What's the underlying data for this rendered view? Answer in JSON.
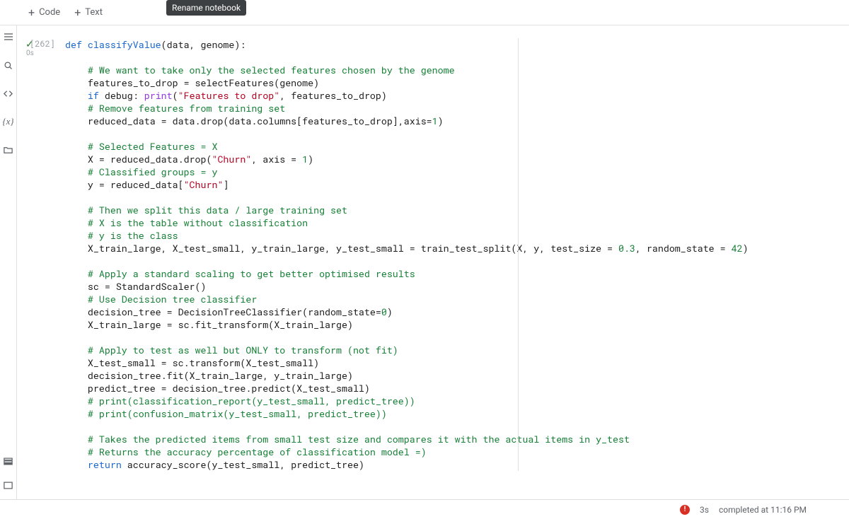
{
  "toolbar": {
    "code_label": "Code",
    "text_label": "Text"
  },
  "tooltip": "Rename notebook",
  "leftrail": {
    "icons": [
      "menu-icon",
      "toc-icon",
      "search-icon",
      "code-snippet-icon",
      "variables-icon",
      "folder-icon",
      "command-palette-icon",
      "terminal-icon"
    ]
  },
  "cell": {
    "exec_count": "[262]",
    "run_time_label": "0s",
    "code_lines": [
      {
        "t": "code",
        "seg": [
          [
            "kw",
            "def "
          ],
          [
            "fn",
            "classifyValue"
          ],
          [
            "id",
            "(data, genome):"
          ]
        ]
      },
      {
        "t": "blank"
      },
      {
        "t": "code",
        "seg": [
          [
            "id",
            "    "
          ],
          [
            "cm",
            "# We want to take only the selected features chosen by the genome"
          ]
        ]
      },
      {
        "t": "code",
        "seg": [
          [
            "id",
            "    features_to_drop = selectFeatures(genome)"
          ]
        ]
      },
      {
        "t": "code",
        "seg": [
          [
            "id",
            "    "
          ],
          [
            "kw",
            "if"
          ],
          [
            "id",
            " debug: "
          ],
          [
            "bn",
            "print"
          ],
          [
            "id",
            "("
          ],
          [
            "str",
            "\"Features to drop\""
          ],
          [
            "id",
            ", features_to_drop)"
          ]
        ]
      },
      {
        "t": "code",
        "seg": [
          [
            "id",
            "    "
          ],
          [
            "cm",
            "# Remove features from training set"
          ]
        ]
      },
      {
        "t": "code",
        "seg": [
          [
            "id",
            "    reduced_data = data.drop(data.columns[features_to_drop],axis="
          ],
          [
            "num",
            "1"
          ],
          [
            "id",
            ")"
          ]
        ]
      },
      {
        "t": "blank"
      },
      {
        "t": "code",
        "seg": [
          [
            "id",
            "    "
          ],
          [
            "cm",
            "# Selected Features = X"
          ]
        ]
      },
      {
        "t": "code",
        "seg": [
          [
            "id",
            "    X = reduced_data.drop("
          ],
          [
            "str",
            "\"Churn\""
          ],
          [
            "id",
            ", axis = "
          ],
          [
            "num",
            "1"
          ],
          [
            "id",
            ")"
          ]
        ]
      },
      {
        "t": "code",
        "seg": [
          [
            "id",
            "    "
          ],
          [
            "cm",
            "# Classified groups = y"
          ]
        ]
      },
      {
        "t": "code",
        "seg": [
          [
            "id",
            "    y = reduced_data["
          ],
          [
            "str",
            "\"Churn\""
          ],
          [
            "id",
            "]"
          ]
        ]
      },
      {
        "t": "blank"
      },
      {
        "t": "code",
        "seg": [
          [
            "id",
            "    "
          ],
          [
            "cm",
            "# Then we split this data / large training set"
          ]
        ]
      },
      {
        "t": "code",
        "seg": [
          [
            "id",
            "    "
          ],
          [
            "cm",
            "# X is the table without classification"
          ]
        ]
      },
      {
        "t": "code",
        "seg": [
          [
            "id",
            "    "
          ],
          [
            "cm",
            "# y is the class"
          ]
        ]
      },
      {
        "t": "code",
        "seg": [
          [
            "id",
            "    X_train_large, X_test_small, y_train_large, y_test_small = train_test_split(X, y, test_size = "
          ],
          [
            "num",
            "0.3"
          ],
          [
            "id",
            ", random_state = "
          ],
          [
            "num",
            "42"
          ],
          [
            "id",
            ")"
          ]
        ]
      },
      {
        "t": "blank"
      },
      {
        "t": "code",
        "seg": [
          [
            "id",
            "    "
          ],
          [
            "cm",
            "# Apply a standard scaling to get better optimised results"
          ]
        ]
      },
      {
        "t": "code",
        "seg": [
          [
            "id",
            "    sc = StandardScaler()"
          ]
        ]
      },
      {
        "t": "code",
        "seg": [
          [
            "id",
            "    "
          ],
          [
            "cm",
            "# Use Decision tree classifier"
          ]
        ]
      },
      {
        "t": "code",
        "seg": [
          [
            "id",
            "    decision_tree = DecisionTreeClassifier(random_state="
          ],
          [
            "num",
            "0"
          ],
          [
            "id",
            ")"
          ]
        ]
      },
      {
        "t": "code",
        "seg": [
          [
            "id",
            "    X_train_large = sc.fit_transform(X_train_large)"
          ]
        ]
      },
      {
        "t": "blank"
      },
      {
        "t": "code",
        "seg": [
          [
            "id",
            "    "
          ],
          [
            "cm",
            "# Apply to test as well but ONLY to transform (not fit)"
          ]
        ]
      },
      {
        "t": "code",
        "seg": [
          [
            "id",
            "    X_test_small = sc.transform(X_test_small)"
          ]
        ]
      },
      {
        "t": "code",
        "seg": [
          [
            "id",
            "    decision_tree.fit(X_train_large, y_train_large)"
          ]
        ]
      },
      {
        "t": "code",
        "seg": [
          [
            "id",
            "    predict_tree = decision_tree.predict(X_test_small)"
          ]
        ]
      },
      {
        "t": "code",
        "seg": [
          [
            "id",
            "    "
          ],
          [
            "cm",
            "# print(classification_report(y_test_small, predict_tree))"
          ]
        ]
      },
      {
        "t": "code",
        "seg": [
          [
            "id",
            "    "
          ],
          [
            "cm",
            "# print(confusion_matrix(y_test_small, predict_tree))"
          ]
        ]
      },
      {
        "t": "blank"
      },
      {
        "t": "code",
        "seg": [
          [
            "id",
            "    "
          ],
          [
            "cm",
            "# Takes the predicted items from small test size and compares it with the actual items in y_test"
          ]
        ]
      },
      {
        "t": "code",
        "seg": [
          [
            "id",
            "    "
          ],
          [
            "cm",
            "# Returns the accuracy percentage of classification model =)"
          ]
        ]
      },
      {
        "t": "code",
        "seg": [
          [
            "id",
            "    "
          ],
          [
            "kw",
            "return"
          ],
          [
            "id",
            " accuracy_score(y_test_small, predict_tree)"
          ]
        ]
      }
    ],
    "guide_col": 80
  },
  "statusbar": {
    "duration": "3s",
    "completed": "completed at 11:16 PM"
  }
}
